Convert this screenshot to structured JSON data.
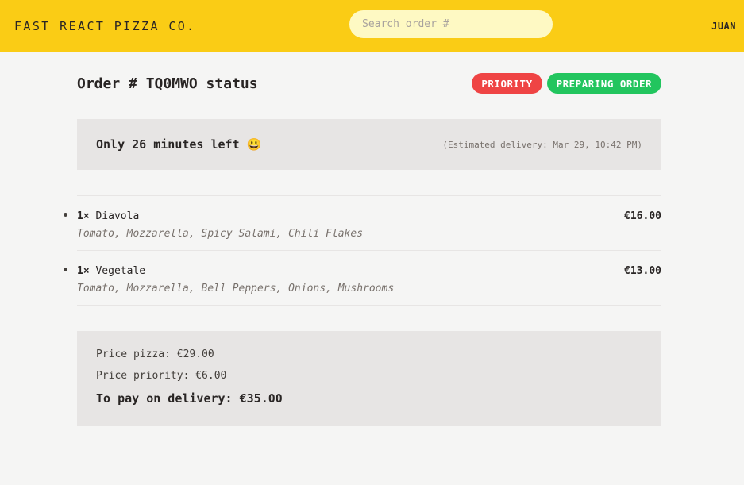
{
  "header": {
    "logo": "FAST REACT PIZZA CO.",
    "search_placeholder": "Search order #",
    "username": "JUAN"
  },
  "order": {
    "title": "Order # TQ0MWO status",
    "badges": {
      "priority": "PRIORITY",
      "status": "PREPARING ORDER"
    },
    "countdown": "Only 26 minutes left 😃",
    "estimated": "(Estimated delivery: Mar 29, 10:42 PM)",
    "items": [
      {
        "quantity": "1×",
        "name": "Diavola",
        "price": "€16.00",
        "ingredients": "Tomato, Mozzarella, Spicy Salami, Chili Flakes"
      },
      {
        "quantity": "1×",
        "name": "Vegetale",
        "price": "€13.00",
        "ingredients": "Tomato, Mozzarella, Bell Peppers, Onions, Mushrooms"
      }
    ],
    "totals": {
      "price_pizza": "Price pizza: €29.00",
      "price_priority": "Price priority: €6.00",
      "to_pay": "To pay on delivery: €35.00"
    }
  },
  "colors": {
    "header_bg": "#facc15",
    "search_bg": "#fef9c3",
    "priority": "#ef4444",
    "status": "#22c55e",
    "panel_bg": "#e7e5e4"
  }
}
